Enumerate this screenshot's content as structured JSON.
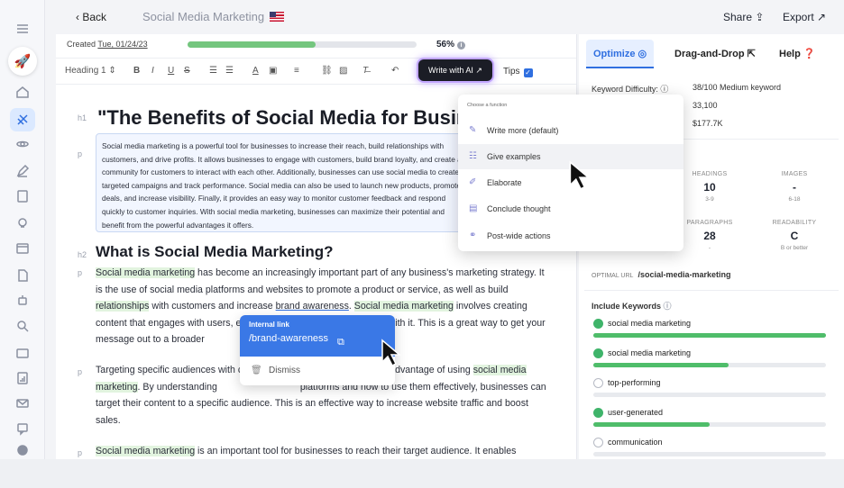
{
  "header": {
    "back_label": "Back",
    "doc_title": "Social Media Marketing",
    "share_label": "Share",
    "export_label": "Export"
  },
  "editor": {
    "created_prefix": "Created",
    "created_date": "Tue, 01/24/23",
    "progress_pct": 56,
    "progress_label": "56%",
    "toolbar": {
      "heading_select": "Heading 1",
      "bold": "B",
      "italic": "I",
      "underline": "U",
      "strike": "S",
      "write_ai": "Write with AI",
      "tips": "Tips"
    },
    "tags": {
      "h1": "h1",
      "p": "p",
      "h2": "h2"
    },
    "h1": "\"The Benefits of Social Media for Busin",
    "intro": "Social media marketing is a powerful tool for businesses to increase their reach, build relationships with customers, and drive profits. It allows businesses to engage with customers, build brand loyalty, and create a community for customers to interact with each other. Additionally, businesses can use social media to create targeted campaigns and track performance. Social media can also be used to launch new products, promote deals, and increase visibility. Finally, it provides an easy way to monitor customer feedback and respond quickly to customer inquiries. With social media marketing, businesses can maximize their potential and benefit from the powerful advantages it offers.",
    "h2": "What is Social Media Marketing?",
    "p1": {
      "a": "Social media marketing",
      "b": " has become an increasingly important part of any business's marketing strategy. It is the use of social media platforms and websites to promote a product or service, as well as build ",
      "c": "relationships",
      "d": " with customers and increase ",
      "e": "brand awareness",
      "f": ". ",
      "g": "Social media marketing",
      "h": " involves creating content that engages with users, e",
      "i": "ct with it. This is a great way to get your message out to a broader"
    },
    "p2": {
      "a": "Targeting specific audiences with c",
      "b": "other advantage of using ",
      "c": "social media marketing",
      "d": ". By understanding",
      "e": "platforms and how to use them effectively, businesses can target their content to a specific audience. This is an effective way to increase website traffic and boost sales."
    },
    "p3": {
      "a": "Social media marketing",
      "b": " is an important tool for businesses to reach their target audience. It enables"
    },
    "link_popup": {
      "label": "Internal link",
      "url": "/brand-awareness",
      "dismiss": "Dismiss"
    }
  },
  "ai_menu": {
    "heading": "Choose a function",
    "items": [
      "Write more (default)",
      "Give examples",
      "Elaborate",
      "Conclude thought",
      "Post-wide actions"
    ],
    "selected": "Give examples"
  },
  "panel": {
    "tabs": [
      "Optimize",
      "Drag-and-Drop",
      "Help"
    ],
    "keyword_difficulty_label": "Keyword Difficulty:",
    "keyword_difficulty_value": "38/100 Medium keyword",
    "volume": "33,100",
    "cpc": "$177.7K",
    "stats": [
      {
        "key": "HEADINGS",
        "value": "10",
        "range": "3-9"
      },
      {
        "key": "IMAGES",
        "value": "-",
        "range": "6-18"
      },
      {
        "key": "PARAGRAPHS",
        "value": "28",
        "range": "-"
      },
      {
        "key": "READABILITY",
        "value": "C",
        "range": "B or better"
      }
    ],
    "optimal_url_label": "OPTIMAL URL",
    "optimal_url": "/social-media-marketing",
    "include_keywords_label": "Include Keywords",
    "keywords": [
      {
        "name": "social media marketing",
        "done": true,
        "fill": 1.0
      },
      {
        "name": "social media marketing",
        "done": true,
        "fill": 0.58
      },
      {
        "name": "top-performing",
        "done": false,
        "fill": 0
      },
      {
        "name": "user-generated",
        "done": true,
        "fill": 0.5
      },
      {
        "name": "communication",
        "done": false,
        "fill": 0
      }
    ]
  },
  "colors": {
    "accent": "#2f6fe0",
    "highlight": "#e2f4df",
    "progress": "#74c67e"
  }
}
